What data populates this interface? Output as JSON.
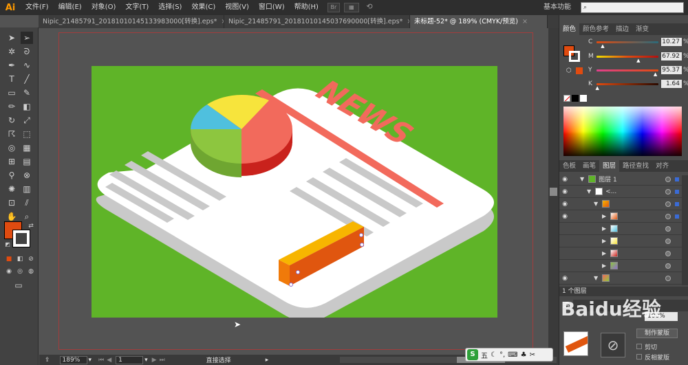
{
  "app": {
    "logo_text": "Ai"
  },
  "menu": {
    "items": [
      "文件(F)",
      "编辑(E)",
      "对象(O)",
      "文字(T)",
      "选择(S)",
      "效果(C)",
      "视图(V)",
      "窗口(W)",
      "帮助(H)"
    ],
    "bridge_label": "Br",
    "workspace": "基本功能"
  },
  "tabs": [
    {
      "label": "Nipic_21485791_20181010145133983000[转换].eps*",
      "active": false
    },
    {
      "label": "Nipic_21485791_20181010145037690000[转换].eps*",
      "active": false
    },
    {
      "label": "未标题-52* @ 189% (CMYK/预览)",
      "active": true
    }
  ],
  "tab_close": "×",
  "status": {
    "zoom": "189%",
    "artboard": "1",
    "tool": "直接选择"
  },
  "color_panel": {
    "tabs": [
      "颜色",
      "颜色参考",
      "描边",
      "渐变"
    ],
    "channels": [
      {
        "label": "C",
        "value": "10.27",
        "fraction": 0.1027
      },
      {
        "label": "M",
        "value": "67.92",
        "fraction": 0.6792
      },
      {
        "label": "Y",
        "value": "95.37",
        "fraction": 0.9537
      },
      {
        "label": "K",
        "value": "1.64",
        "fraction": 0.0164
      }
    ],
    "percent": "%",
    "fill_color": "#e04b10"
  },
  "layers_panel": {
    "tabs": [
      "色板",
      "画笔",
      "图层",
      "路径查找",
      "对齐"
    ],
    "top_layer": "图层 1",
    "sub_label": "<...",
    "footer": "1 个图层"
  },
  "lower_panel": {
    "tabs": [
      "透"
    ],
    "opacity": "100%",
    "mask_button": "制作蒙版",
    "clip": "剪切",
    "invert": "反相蒙版"
  },
  "ime": {
    "logo": "S",
    "label": "五"
  },
  "watermark": "Baidu经验",
  "artwork": {
    "news_text": "NEWS",
    "colors": {
      "background": "#5fb428",
      "paper": "#ffffff",
      "paper_edge": "#c9c9c9",
      "red": "#f26a5c",
      "yellow": "#f7e43c",
      "green": "#8dc63f",
      "blue": "#4fc0de",
      "bar_top": "#f7b500",
      "bar_side": "#e86d12"
    }
  }
}
